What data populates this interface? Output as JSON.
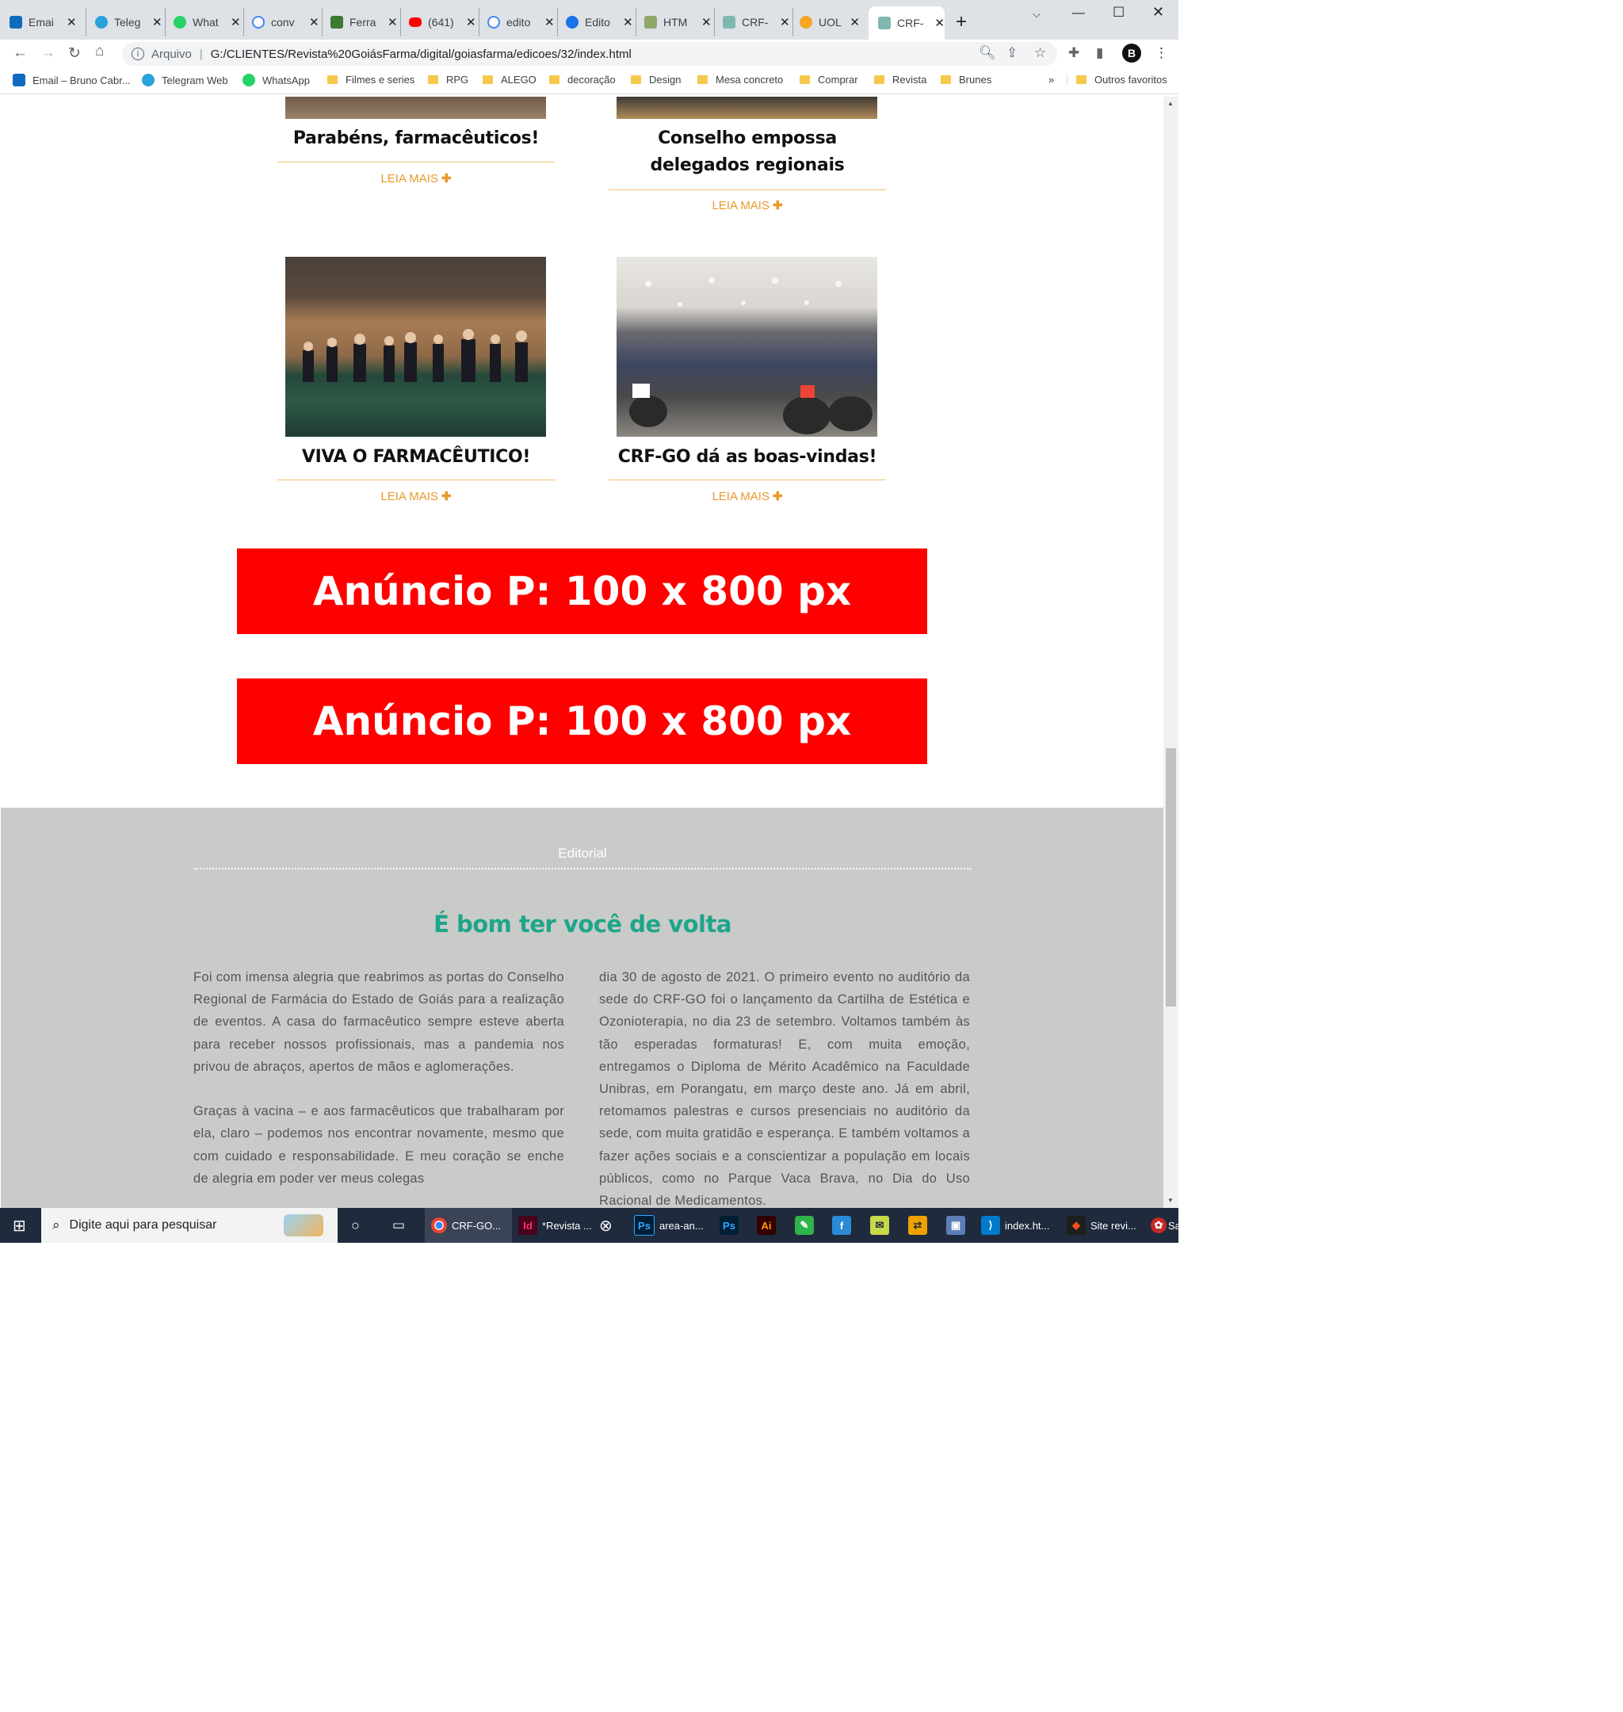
{
  "browser": {
    "tabs": [
      {
        "title": "Emai",
        "color": "#0f6cbd"
      },
      {
        "title": "Teleg",
        "color": "#2aa1da"
      },
      {
        "title": "What",
        "color": "#25d366"
      },
      {
        "title": "conv",
        "color": "#4285f4"
      },
      {
        "title": "Ferra",
        "color": "#3a7a32"
      },
      {
        "title": "(641)",
        "color": "#ff0000"
      },
      {
        "title": "edito",
        "color": "#4285f4"
      },
      {
        "title": "Edito",
        "color": "#1a73e8"
      },
      {
        "title": "HTM",
        "color": "#8fa86a"
      },
      {
        "title": "CRF-",
        "color": "#7fb8b0"
      },
      {
        "title": "UOL",
        "color": "#f5a623"
      },
      {
        "title": "CRF-",
        "color": "#7fb8b0"
      }
    ],
    "new_tab": "+",
    "address": {
      "protocol_label": "Arquivo",
      "url": "G:/CLIENTES/Revista%20GoiásFarma/digital/goiasfarma/edicoes/32/index.html"
    },
    "profile_initial": "B",
    "bookmarks": [
      {
        "label": "Email – Bruno Cabr...",
        "icon": "outlook-icon"
      },
      {
        "label": "Telegram Web",
        "icon": "telegram-icon"
      },
      {
        "label": "WhatsApp",
        "icon": "whatsapp-icon"
      },
      {
        "label": "Filmes e series",
        "icon": "folder-icon"
      },
      {
        "label": "RPG",
        "icon": "folder-icon"
      },
      {
        "label": "ALEGO",
        "icon": "folder-icon"
      },
      {
        "label": "decoração",
        "icon": "folder-icon"
      },
      {
        "label": "Design",
        "icon": "folder-icon"
      },
      {
        "label": "Mesa concreto",
        "icon": "folder-icon"
      },
      {
        "label": "Comprar",
        "icon": "folder-icon"
      },
      {
        "label": "Revista",
        "icon": "folder-icon"
      },
      {
        "label": "Brunes",
        "icon": "folder-icon"
      }
    ],
    "bookmarks_overflow": "»",
    "other_bookmarks": "Outros favoritos"
  },
  "page": {
    "cards": [
      {
        "title": "Parabéns, farmacêuticos!",
        "link": "LEIA MAIS"
      },
      {
        "title": "Conselho empossa delegados regionais",
        "link": "LEIA MAIS"
      },
      {
        "title": "VIVA O FARMACÊUTICO!",
        "link": "LEIA MAIS"
      },
      {
        "title": "CRF-GO dá as boas-vindas!",
        "link": "LEIA MAIS"
      }
    ],
    "plus": "✚",
    "ads": [
      {
        "text": "Anúncio P: 100 x 800 px"
      },
      {
        "text": "Anúncio P: 100 x 800 px"
      }
    ],
    "editorial": {
      "label": "Editorial",
      "title": "É bom ter você de volta",
      "col1_p1": "Foi com imensa alegria que reabrimos as portas do Conselho Regional de Farmácia do Estado de Goiás para a realização de eventos. A casa do farmacêutico sempre esteve aberta para receber nossos profissionais, mas a pandemia nos privou de abraços, apertos de mãos e aglomerações.",
      "col1_p2": "Graças à vacina – e aos farmacêuticos que trabalharam por ela, claro – podemos nos encontrar novamente, mesmo que com cuidado e responsabilidade. E meu coração se enche de alegria em poder ver meus colegas",
      "col2_p1": "dia 30 de agosto de 2021. O primeiro evento no auditório da sede do CRF-GO foi o lançamento da Cartilha de Estética e Ozonioterapia, no dia 23 de setembro. Voltamos também às tão esperadas formaturas! E, com muita emoção, entregamos o Diploma de Mérito Acadêmico na Faculdade Unibras, em Porangatu, em março deste ano. Já em abril, retomamos palestras e cursos presenciais no auditório da sede, com muita gratidão e esperança. E também voltamos a fazer ações sociais e a conscientizar a população em locais públicos, como no Parque Vaca Brava, no Dia do Uso Racional de Medicamentos."
    }
  },
  "taskbar": {
    "search_placeholder": "Digite aqui para pesquisar",
    "apps": [
      {
        "label": "CRF-GO...",
        "icon": "chrome-icon"
      },
      {
        "label": "*Revista ...",
        "icon": "indesign-icon",
        "glyph": "Id"
      },
      {
        "label": "area-an...",
        "icon": "photoshop-icon",
        "glyph": "Ps"
      },
      {
        "label": "index.ht...",
        "icon": "vscode-icon"
      },
      {
        "label": "Site revi...",
        "icon": "figma-icon"
      }
    ],
    "ps_glyph": "Ps",
    "ai_glyph": "Ai",
    "f_glyph": "f",
    "last_label": "Sa"
  },
  "colors": {
    "accent_orange": "#e89a2a",
    "ad_red": "#fe0000",
    "editorial_bg": "#c8cbc8",
    "editorial_title": "#1ea58a"
  }
}
